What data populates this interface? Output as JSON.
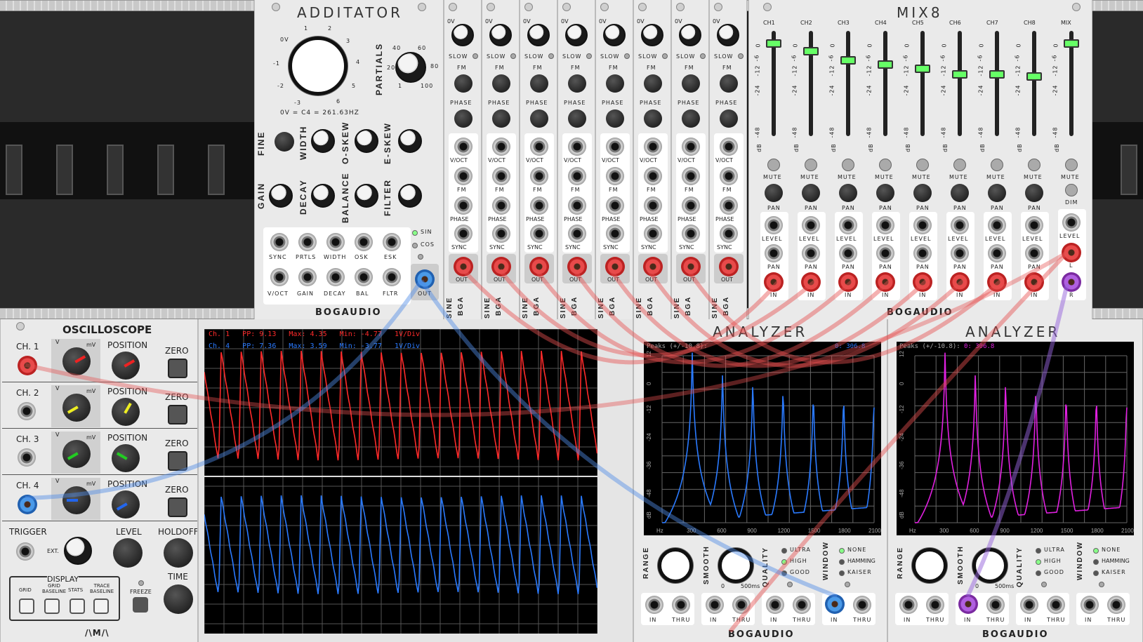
{
  "additator": {
    "title": "ADDITATOR",
    "brand": "BOGAUDIO",
    "freq_label": "0V = C4 = 261.63HZ",
    "freq_scale": [
      "0V",
      "1",
      "2",
      "3",
      "4",
      "5",
      "6",
      "-3",
      "-2",
      "-1"
    ],
    "partials_label": "PARTIALS",
    "partials_scale": [
      "40",
      "60",
      "80",
      "100",
      "1",
      "20"
    ],
    "knob_labels": [
      "FINE",
      "WIDTH",
      "O-SKEW",
      "E-SKEW",
      "GAIN",
      "DECAY",
      "BALANCE",
      "FILTER"
    ],
    "cv_labels_row1": [
      "SYNC",
      "PRTLS",
      "WIDTH",
      "OSK",
      "ESK"
    ],
    "cv_labels_row2": [
      "V/OCT",
      "GAIN",
      "DECAY",
      "BAL",
      "FLTR"
    ],
    "mode": [
      "SIN",
      "COS"
    ],
    "out": "OUT"
  },
  "sine": {
    "labels": {
      "zero": "0V",
      "slow": "SLOW",
      "fm": "FM",
      "phase": "PHASE",
      "voct": "V/OCT",
      "sync": "SYNC",
      "out": "OUT",
      "name": "SINE",
      "brand": "BGA"
    },
    "count": 8
  },
  "mix8": {
    "title": "MIX8",
    "brand": "BOGAUDIO",
    "channels": [
      "CH1",
      "CH2",
      "CH3",
      "CH4",
      "CH5",
      "CH6",
      "CH7",
      "CH8",
      "MIX"
    ],
    "fader_levels": [
      0.92,
      0.85,
      0.76,
      0.72,
      0.68,
      0.63,
      0.63,
      0.61,
      0.92
    ],
    "scale": [
      "0",
      "-6",
      "-12",
      "-24",
      "-48",
      "dB"
    ],
    "labels": {
      "mute": "MUTE",
      "pan": "PAN",
      "level": "LEVEL",
      "in": "IN",
      "dim": "DIM",
      "l": "L",
      "r": "R"
    }
  },
  "oscilloscope": {
    "title": "OSCILLOSCOPE",
    "channels": [
      "CH. 1",
      "CH. 2",
      "CH. 3",
      "CH. 4"
    ],
    "position": "POSITION",
    "zero": "ZERO",
    "trigger": "TRIGGER",
    "ext": "EXT.",
    "level": "LEVEL",
    "holdoff": "HOLDOFF",
    "display": "DISPLAY",
    "display_opts": [
      "GRID",
      "GRID BASELINE",
      "STATS",
      "TRACE BASELINE"
    ],
    "freeze": "FREEZE",
    "time": "TIME",
    "scale_v": "V",
    "scale_mv": "mV",
    "stats": [
      {
        "ch": "Ch. 1",
        "pp": "PP: 9.13",
        "max": "Max: 4.35",
        "min": "Min: -4.77",
        "div": "1V/Div"
      },
      {
        "ch": "Ch. 4",
        "pp": "PP: 7.36",
        "max": "Max: 3.59",
        "min": "Min: -3.77",
        "div": "1V/Div"
      }
    ],
    "colors": {
      "ch1": "#ff2a2a",
      "ch4": "#2a7aff"
    }
  },
  "analyzer_left": {
    "title": "ANALYZER",
    "brand": "BOGAUDIO",
    "peaks": "Peaks (+/-10.8):",
    "peak_val": "0:  306.8",
    "y_ticks": [
      "12",
      "0",
      "-12",
      "-24",
      "-36",
      "-48",
      "dB"
    ],
    "x_ticks": [
      "Hz",
      "300",
      "600",
      "900",
      "1200",
      "1500",
      "1800",
      "2100"
    ],
    "range": "RANGE",
    "smooth": "SMOOTH",
    "quality": "QUALITY",
    "window": "WINDOW",
    "smooth_scale": [
      "0",
      "500ms"
    ],
    "quality_opts": [
      "ULTRA",
      "HIGH",
      "GOOD"
    ],
    "window_opts": [
      "NONE",
      "HAMMING",
      "KAISER"
    ],
    "jacks": [
      "IN",
      "THRU",
      "IN",
      "THRU",
      "IN",
      "THRU",
      "IN",
      "THRU"
    ],
    "color": "#2a7aff"
  },
  "analyzer_right": {
    "title": "ANALYZER",
    "brand": "BOGAUDIO",
    "peaks": "Peaks (+/-10.8):",
    "peak_val": "0:  306.8",
    "color": "#e020e0"
  }
}
